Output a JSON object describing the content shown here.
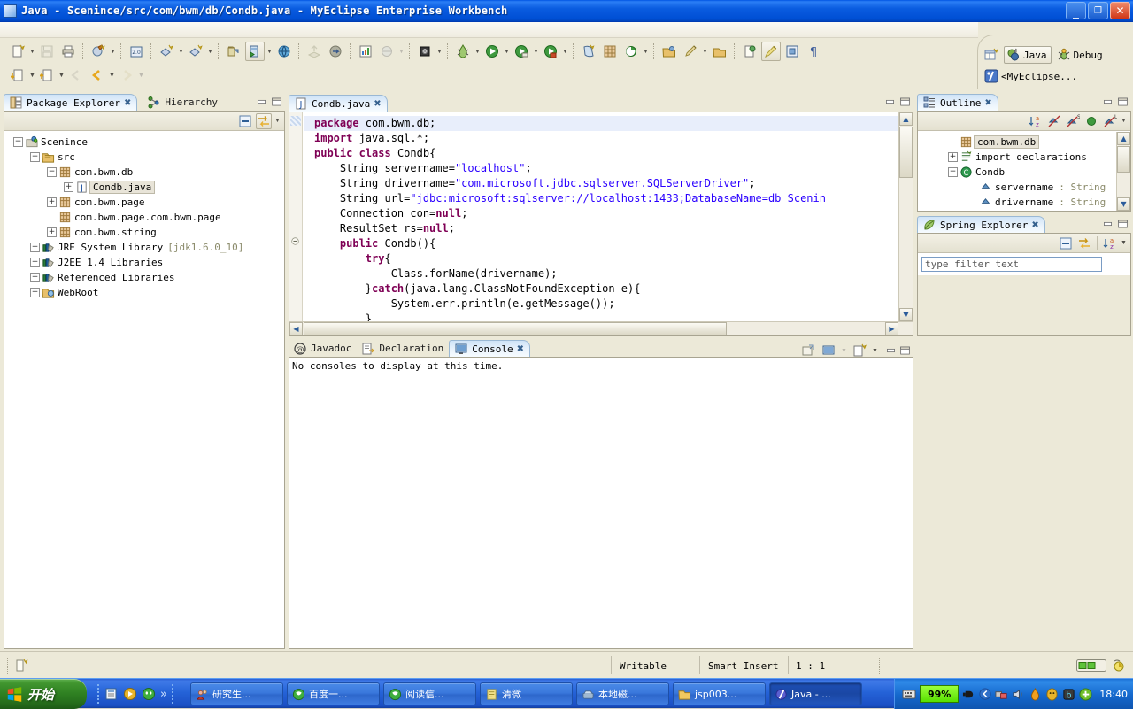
{
  "window": {
    "title": "Java - Scenince/src/com/bwm/db/Condb.java - MyEclipse Enterprise Workbench",
    "minimize_label": "_",
    "restore_label": "❐",
    "close_label": "×",
    "titlebar_color": "#0a5ce0"
  },
  "perspective_bar": {
    "open_perspective_icon": "open-perspective-icon",
    "items": [
      {
        "label": "Java",
        "icon": "java-perspective-icon",
        "active": true
      },
      {
        "label": "Debug",
        "icon": "debug-perspective-icon",
        "active": false
      },
      {
        "label": "<MyEclipse...",
        "icon": "myeclipse-perspective-icon",
        "active": false
      }
    ]
  },
  "toolbar": {
    "row1": [
      {
        "name": "new-wizard",
        "icon": "new-file-icon",
        "arrow": true
      },
      {
        "name": "save",
        "icon": "save-icon",
        "arrow": false,
        "disabled": true
      },
      {
        "name": "print",
        "icon": "print-icon",
        "arrow": false
      },
      {
        "sep": true
      },
      {
        "name": "build-all",
        "icon": "build-icon",
        "arrow": true
      },
      {
        "sep": true
      },
      {
        "name": "open-type",
        "icon": "open-type-icon",
        "arrow": false
      },
      {
        "sep": true
      },
      {
        "name": "new-java-package",
        "icon": "new-package-icon",
        "arrow": true
      },
      {
        "name": "new-java-class",
        "icon": "new-class-icon",
        "arrow": true
      },
      {
        "sep": true
      },
      {
        "name": "deploy-myeclipse",
        "icon": "deploy-icon",
        "arrow": false
      },
      {
        "name": "run-server",
        "icon": "run-server-icon",
        "arrow": true,
        "pressed": true
      },
      {
        "name": "open-browser",
        "icon": "web-browser-icon",
        "arrow": false
      },
      {
        "sep": true
      },
      {
        "name": "export-war",
        "icon": "export-icon",
        "arrow": false,
        "disabled": true
      },
      {
        "name": "import-project",
        "icon": "import-icon",
        "arrow": false
      },
      {
        "sep": true
      },
      {
        "name": "open-report",
        "icon": "report-icon",
        "arrow": false
      },
      {
        "name": "web-services",
        "icon": "globe-icon",
        "arrow": true,
        "disabled": true
      },
      {
        "sep": true
      },
      {
        "name": "database-explorer",
        "icon": "database-icon",
        "arrow": true
      },
      {
        "sep": true
      },
      {
        "name": "debug",
        "icon": "debug-bug-icon",
        "arrow": true
      },
      {
        "name": "run",
        "icon": "run-play-icon",
        "arrow": true
      },
      {
        "name": "run-history",
        "icon": "run-history-icon",
        "arrow": true
      },
      {
        "name": "run-external",
        "icon": "run-external-icon",
        "arrow": true
      },
      {
        "sep": true
      },
      {
        "name": "new-xml",
        "icon": "new-xml-icon",
        "arrow": false
      },
      {
        "name": "new-grid",
        "icon": "new-grid-icon",
        "arrow": false
      },
      {
        "name": "new-struts",
        "icon": "struts-icon",
        "arrow": true
      },
      {
        "sep": true
      },
      {
        "name": "open-resource",
        "icon": "open-folder-icon",
        "arrow": false
      },
      {
        "name": "search",
        "icon": "search-pencil-icon",
        "arrow": true
      },
      {
        "name": "open-task",
        "icon": "task-folder-icon",
        "arrow": false
      },
      {
        "sep": true
      },
      {
        "name": "toggle-marks",
        "icon": "mark-occurrences-icon",
        "arrow": false
      },
      {
        "name": "toggle-highlight",
        "icon": "highlight-icon",
        "arrow": false,
        "pressed": true
      },
      {
        "name": "toggle-block-select",
        "icon": "block-select-icon",
        "arrow": false
      },
      {
        "name": "show-whitespace",
        "icon": "pilcrow-icon",
        "arrow": false
      }
    ],
    "row2": [
      {
        "name": "previous-annotation",
        "icon": "down-annotation-icon",
        "arrow": true
      },
      {
        "name": "next-annotation",
        "icon": "up-annotation-icon",
        "arrow": true
      },
      {
        "name": "back-history",
        "icon": "back-gray-icon",
        "arrow": false,
        "disabled": true
      },
      {
        "name": "back",
        "icon": "back-arrow-icon",
        "arrow": true
      },
      {
        "name": "forward",
        "icon": "forward-arrow-icon",
        "arrow": true,
        "disabled": true
      }
    ]
  },
  "package_explorer": {
    "tabs": [
      {
        "label": "Package Explorer",
        "icon": "package-explorer-icon",
        "active": true,
        "closable": true
      },
      {
        "label": "Hierarchy",
        "icon": "hierarchy-icon",
        "active": false,
        "closable": false
      }
    ],
    "toolbar": [
      {
        "name": "collapse-all-button",
        "icon": "collapse-all-icon"
      },
      {
        "name": "link-with-editor-button",
        "icon": "link-editor-icon",
        "pressed": true
      },
      {
        "name": "view-menu-button",
        "icon": "chevron-down-icon"
      }
    ],
    "tree": [
      {
        "label": "Scenince",
        "icon": "java-project-icon",
        "indent": 0,
        "expander": "-"
      },
      {
        "label": "src",
        "icon": "source-folder-icon",
        "indent": 1,
        "expander": "-"
      },
      {
        "label": "com.bwm.db",
        "icon": "package-icon",
        "indent": 2,
        "expander": "-"
      },
      {
        "label": "Condb.java",
        "icon": "java-file-icon",
        "indent": 3,
        "expander": "+",
        "selected": true
      },
      {
        "label": "com.bwm.page",
        "icon": "package-icon",
        "indent": 2,
        "expander": "+"
      },
      {
        "label": "com.bwm.page.com.bwm.page",
        "icon": "package-icon",
        "indent": 2,
        "expander": ""
      },
      {
        "label": "com.bwm.string",
        "icon": "package-icon",
        "indent": 2,
        "expander": "+"
      },
      {
        "label": "JRE System Library",
        "suffix": "[jdk1.6.0_10]",
        "icon": "library-icon",
        "indent": 1,
        "expander": "+"
      },
      {
        "label": "J2EE 1.4 Libraries",
        "icon": "library-icon",
        "indent": 1,
        "expander": "+"
      },
      {
        "label": "Referenced Libraries",
        "icon": "library-icon",
        "indent": 1,
        "expander": "+"
      },
      {
        "label": "WebRoot",
        "icon": "webroot-folder-icon",
        "indent": 1,
        "expander": "+"
      }
    ]
  },
  "editor": {
    "tab": {
      "label": "Condb.java",
      "icon": "java-file-icon",
      "close": "✖"
    },
    "code": [
      {
        "current": true,
        "tokens": [
          {
            "t": "package",
            "c": "kw"
          },
          {
            "t": " com.bwm.db;",
            "c": "pl"
          }
        ]
      },
      {
        "tokens": [
          {
            "t": "import",
            "c": "kw"
          },
          {
            "t": " java.sql.*;",
            "c": "pl"
          }
        ]
      },
      {
        "tokens": [
          {
            "t": "public",
            "c": "kw"
          },
          {
            "t": " ",
            "c": "pl"
          },
          {
            "t": "class",
            "c": "kw"
          },
          {
            "t": " Condb{",
            "c": "pl"
          }
        ]
      },
      {
        "tokens": [
          {
            "t": "    String servername=",
            "c": "pl"
          },
          {
            "t": "\"localhost\"",
            "c": "str"
          },
          {
            "t": ";",
            "c": "pl"
          }
        ]
      },
      {
        "tokens": [
          {
            "t": "    String drivername=",
            "c": "pl"
          },
          {
            "t": "\"com.microsoft.jdbc.sqlserver.SQLServerDriver\"",
            "c": "str"
          },
          {
            "t": ";",
            "c": "pl"
          }
        ]
      },
      {
        "tokens": [
          {
            "t": "    String url=",
            "c": "pl"
          },
          {
            "t": "\"jdbc:microsoft:sqlserver://localhost:1433;DatabaseName=db_Scenin",
            "c": "str"
          }
        ]
      },
      {
        "tokens": [
          {
            "t": "    Connection con=",
            "c": "pl"
          },
          {
            "t": "null",
            "c": "kw"
          },
          {
            "t": ";",
            "c": "pl"
          }
        ]
      },
      {
        "tokens": [
          {
            "t": "    ResultSet rs=",
            "c": "pl"
          },
          {
            "t": "null",
            "c": "kw"
          },
          {
            "t": ";",
            "c": "pl"
          }
        ]
      },
      {
        "fold": true,
        "tokens": [
          {
            "t": "    ",
            "c": "pl"
          },
          {
            "t": "public",
            "c": "kw"
          },
          {
            "t": " Condb(){",
            "c": "pl"
          }
        ]
      },
      {
        "tokens": [
          {
            "t": "        ",
            "c": "pl"
          },
          {
            "t": "try",
            "c": "kw"
          },
          {
            "t": "{",
            "c": "pl"
          }
        ]
      },
      {
        "tokens": [
          {
            "t": "            Class.forName(drivername);",
            "c": "pl"
          }
        ]
      },
      {
        "tokens": [
          {
            "t": "        }",
            "c": "pl"
          },
          {
            "t": "catch",
            "c": "kw"
          },
          {
            "t": "(java.lang.ClassNotFoundException e){",
            "c": "pl"
          }
        ]
      },
      {
        "tokens": [
          {
            "t": "            System.err.println(e.getMessage());",
            "c": "pl"
          }
        ]
      },
      {
        "tokens": [
          {
            "t": "        }",
            "c": "pl"
          }
        ]
      }
    ],
    "minimize_icon": "minimize-icon",
    "maximize_icon": "maximize-icon"
  },
  "bottom_panel": {
    "tabs": [
      {
        "label": "Javadoc",
        "icon": "javadoc-icon",
        "active": false
      },
      {
        "label": "Declaration",
        "icon": "declaration-icon",
        "active": false
      },
      {
        "label": "Console",
        "icon": "console-icon",
        "active": true,
        "closable": true
      }
    ],
    "content": "No consoles to display at this time.",
    "toolbar": [
      {
        "name": "open-console-button",
        "icon": "open-console-icon"
      },
      {
        "name": "display-selected-console-button",
        "icon": "display-console-icon"
      },
      {
        "name": "console-dropdown-button",
        "icon": "chevron-down-icon"
      },
      {
        "name": "new-console-view-button",
        "icon": "new-console-icon",
        "arrow": true
      }
    ]
  },
  "outline": {
    "tab": {
      "label": "Outline",
      "icon": "outline-icon",
      "close": "✖"
    },
    "toolbar": [
      {
        "name": "sort-button",
        "icon": "sort-az-icon"
      },
      {
        "name": "hide-fields-button",
        "icon": "hide-fields-icon"
      },
      {
        "name": "hide-static-button",
        "icon": "hide-static-icon"
      },
      {
        "name": "hide-non-public-button",
        "icon": "hide-nonpublic-icon"
      },
      {
        "name": "hide-local-types-button",
        "icon": "hide-local-icon"
      },
      {
        "name": "view-menu-button",
        "icon": "chevron-down-icon"
      }
    ],
    "tree": [
      {
        "label": "com.bwm.db",
        "icon": "package-icon",
        "indent": 1,
        "expander": "",
        "selected": true
      },
      {
        "label": "import declarations",
        "icon": "import-declarations-icon",
        "indent": 1,
        "expander": "+"
      },
      {
        "label": "Condb",
        "icon": "class-icon",
        "indent": 1,
        "expander": "-"
      },
      {
        "label": "servername",
        "type": ": String",
        "icon": "field-icon",
        "indent": 2,
        "expander": ""
      },
      {
        "label": "drivername",
        "type": ": String",
        "icon": "field-icon",
        "indent": 2,
        "expander": ""
      }
    ]
  },
  "spring_explorer": {
    "tab": {
      "label": "Spring Explorer",
      "icon": "spring-leaf-icon",
      "close": "✖"
    },
    "toolbar": [
      {
        "name": "collapse-all-button",
        "icon": "collapse-all-icon"
      },
      {
        "name": "link-with-editor-button",
        "icon": "link-editor-icon"
      },
      {
        "name": "sort-button",
        "icon": "sort-az-icon"
      },
      {
        "name": "view-menu-button",
        "icon": "chevron-down-icon"
      }
    ],
    "filter_placeholder": "type filter text",
    "filter_value": ""
  },
  "statusbar": {
    "left_icon": "editor-insert-mode-icon",
    "writable": "Writable",
    "insert_mode": "Smart Insert",
    "position": "1 : 1",
    "progress_icon": "progress-bar-icon",
    "heap_icon": "heap-indicator-icon"
  },
  "taskbar": {
    "start_label": "开始",
    "quicklaunch": [
      {
        "name": "show-desktop-icon"
      },
      {
        "name": "media-player-icon"
      },
      {
        "name": "msn-icon"
      },
      {
        "name": "more-chevron-icon",
        "label": "»"
      }
    ],
    "tasks": [
      {
        "label": "研究生...",
        "icon": "window-icon-people",
        "active": false
      },
      {
        "label": "百度一...",
        "icon": "browser-icon",
        "active": false
      },
      {
        "label": "阅读信...",
        "icon": "browser-icon",
        "active": false
      },
      {
        "label": "清微",
        "icon": "notepad-icon",
        "active": false
      },
      {
        "label": "本地磁...",
        "icon": "drive-icon",
        "active": false
      },
      {
        "label": "jsp003...",
        "icon": "folder-icon",
        "active": false
      },
      {
        "label": "Java - ...",
        "icon": "eclipse-icon",
        "active": true
      }
    ],
    "tray": {
      "battery_text": "99%",
      "clock": "18:40",
      "icons": [
        "keyboard-ime-icon",
        "power-icon",
        "show-hidden-icon",
        "network-icon",
        "volume-icon",
        "firewall-icon",
        "qq-icon",
        "antivirus-icon",
        "update-icon"
      ]
    }
  }
}
